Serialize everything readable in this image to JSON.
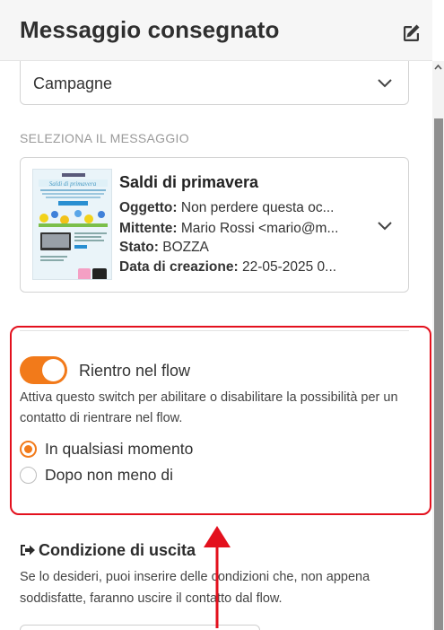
{
  "header": {
    "title": "Messaggio consegnato",
    "edit_icon": "edit-icon"
  },
  "campaign_select": {
    "value": "Campagne"
  },
  "message_section": {
    "label": "SELEZIONA IL MESSAGGIO",
    "card": {
      "title": "Saldi di primavera",
      "subject_label": "Oggetto:",
      "subject_value": " Non perdere questa oc...",
      "sender_label": "Mittente:",
      "sender_value": " Mario Rossi <mario@m...",
      "status_label": "Stato:",
      "status_value": " BOZZA",
      "created_label": "Data di creazione:",
      "created_value": " 22-05-2025 0...",
      "thumbnail_heading": "Saldi di primavera"
    }
  },
  "reentry": {
    "toggle_label": "Rientro nel flow",
    "toggle_on": true,
    "help_text": "Attiva questo switch per abilitare o disabilitare la possibilità per un contatto di rientrare nel flow.",
    "options": [
      {
        "label": "In qualsiasi momento",
        "selected": true
      },
      {
        "label": "Dopo non meno di",
        "selected": false
      }
    ]
  },
  "exit_condition": {
    "title": "Condizione di uscita",
    "text": "Se lo desideri, puoi inserire delle condizioni che, non appena soddisfatte, faranno uscire il contatto dal flow."
  },
  "colors": {
    "accent": "#f27a1a",
    "highlight": "#e3101d"
  }
}
